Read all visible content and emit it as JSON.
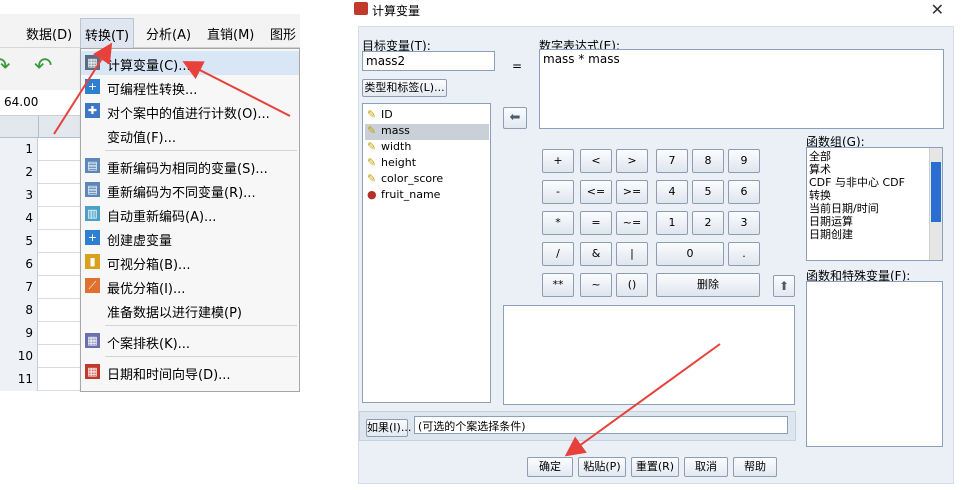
{
  "menubar": {
    "items": [
      "数据(D)",
      "转换(T)",
      "分析(A)",
      "直销(M)",
      "图形"
    ]
  },
  "cell_ref": "64.00",
  "row_numbers": [
    "1",
    "2",
    "3",
    "4",
    "5",
    "6",
    "7",
    "8",
    "9",
    "10",
    "11"
  ],
  "transform_menu": {
    "items": [
      {
        "label": "计算变量(C)...",
        "icon": "calculator-icon"
      },
      {
        "label": "可编程性转换...",
        "icon": "plus-icon"
      },
      {
        "label": "对个案中的值进行计数(O)...",
        "icon": "count-icon"
      },
      {
        "label": "变动值(F)...",
        "icon": ""
      },
      {
        "label": "重新编码为相同的变量(S)...",
        "icon": "recode-icon"
      },
      {
        "label": "重新编码为不同变量(R)...",
        "icon": "recode-icon"
      },
      {
        "label": "自动重新编码(A)...",
        "icon": "auto-recode-icon"
      },
      {
        "label": "创建虚变量",
        "icon": "plus-icon"
      },
      {
        "label": "可视分箱(B)...",
        "icon": "bin-icon"
      },
      {
        "label": "最优分箱(I)...",
        "icon": "optimal-bin-icon"
      },
      {
        "label": "准备数据以进行建模(P)",
        "icon": ""
      },
      {
        "label": "个案排秩(K)...",
        "icon": "rank-icon"
      },
      {
        "label": "日期和时间向导(D)...",
        "icon": "calendar-icon"
      }
    ]
  },
  "dialog": {
    "title": "计算变量",
    "target_label": "目标变量(T):",
    "target_value": "mass2",
    "equals": "=",
    "expr_label": "数字表达式(E):",
    "expr_value": "mass * mass",
    "type_label_button": "类型和标签(L)...",
    "variables": [
      "ID",
      "mass",
      "width",
      "height",
      "color_score",
      "fruit_name"
    ],
    "selected_variable": "mass",
    "keypad": {
      "row1": [
        "+",
        "<",
        ">",
        "7",
        "8",
        "9"
      ],
      "row2": [
        "-",
        "<=",
        ">=",
        "4",
        "5",
        "6"
      ],
      "row3": [
        "*",
        "=",
        "~=",
        "1",
        "2",
        "3"
      ],
      "row4": [
        "/",
        "&",
        "|",
        "0",
        "."
      ],
      "row5": [
        "**",
        "~",
        "()",
        "删除"
      ]
    },
    "function_group_label": "函数组(G):",
    "function_groups": [
      "全部",
      "算术",
      "CDF 与非中心 CDF",
      "转换",
      "当前日期/时间",
      "日期运算",
      "日期创建"
    ],
    "function_special_label": "函数和特殊变量(F):",
    "if_button": "如果(I)...",
    "if_condition": "(可选的个案选择条件)",
    "buttons": {
      "ok": "确定",
      "paste": "粘贴(P)",
      "reset": "重置(R)",
      "cancel": "取消",
      "help": "帮助"
    }
  },
  "colors": {
    "annotation_arrow": "#e8413b",
    "menu_highlight": "#d9e6f5",
    "dialog_bg": "#eaf0f6"
  }
}
